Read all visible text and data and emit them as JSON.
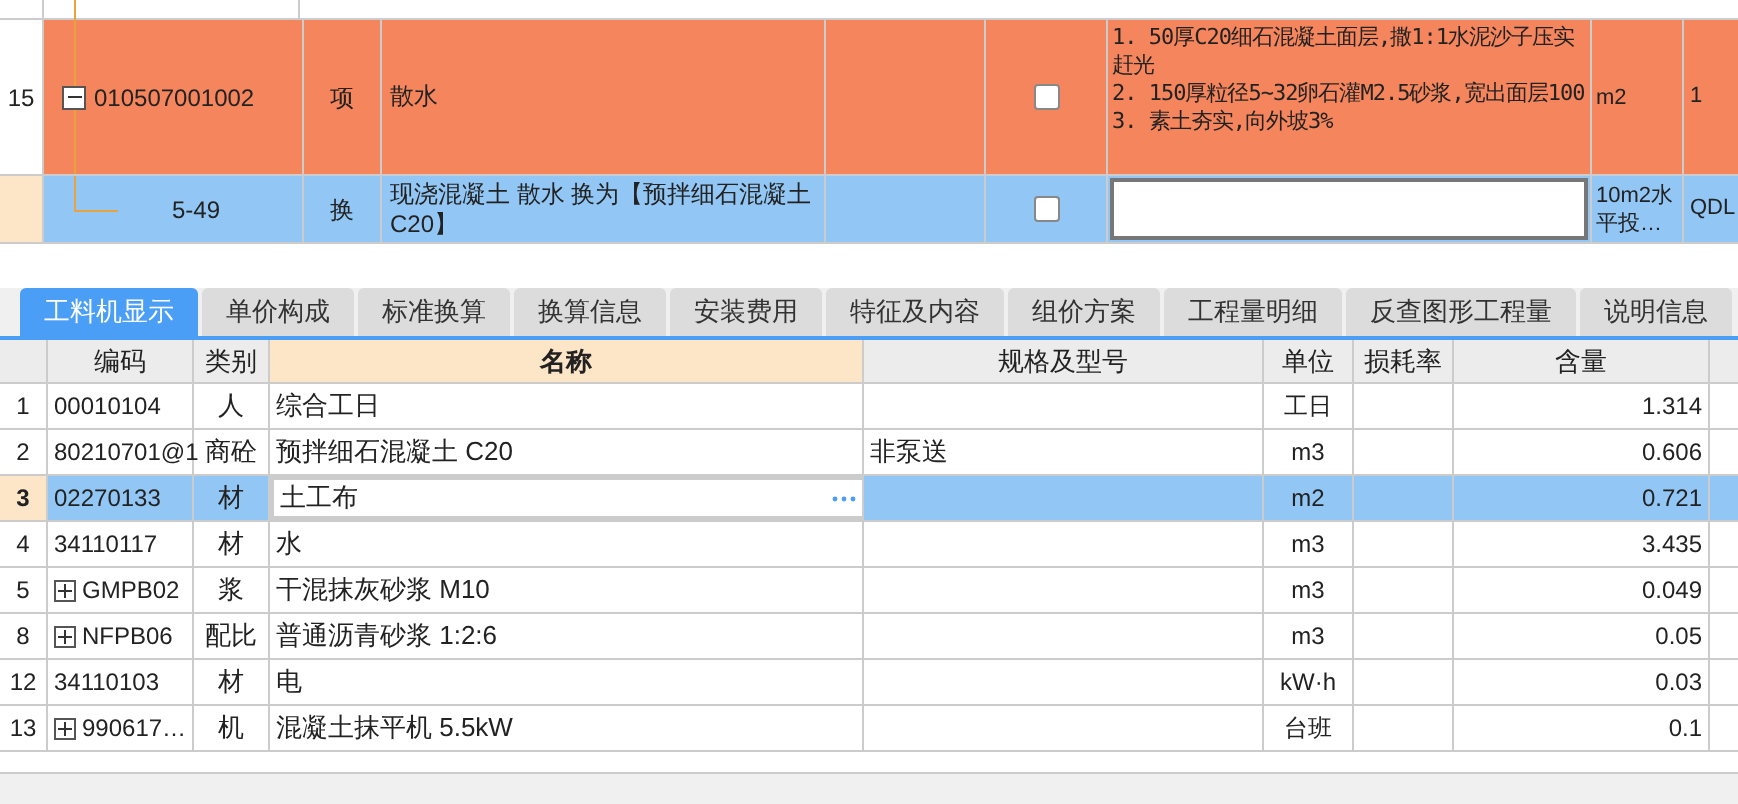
{
  "upper_table": {
    "rows": [
      {
        "row_number": "15",
        "code": "010507001002",
        "expanded": true,
        "type": "项",
        "name": "散水",
        "checked": false,
        "description": "1. 50厚C20细石混凝土面层,撒1:1水泥沙子压实赶光\n2. 150厚粒径5~32卵石灌M2.5砂浆,宽出面层100\n3. 素土夯实,向外坡3%",
        "unit": "m2",
        "quantity": "1",
        "selected": false,
        "editing": false
      },
      {
        "row_number": "",
        "code": "5-49",
        "type": "换",
        "name": "现浇混凝土 散水  换为【预拌细石混凝土 C20】",
        "checked": false,
        "description": "",
        "unit": "10m2水平投…",
        "quantity": "QDL",
        "selected": true,
        "editing": true
      }
    ]
  },
  "tabs": [
    {
      "label": "工料机显示",
      "selected": true
    },
    {
      "label": "单价构成",
      "selected": false
    },
    {
      "label": "标准换算",
      "selected": false
    },
    {
      "label": "换算信息",
      "selected": false
    },
    {
      "label": "安装费用",
      "selected": false
    },
    {
      "label": "特征及内容",
      "selected": false
    },
    {
      "label": "组价方案",
      "selected": false
    },
    {
      "label": "工程量明细",
      "selected": false
    },
    {
      "label": "反查图形工程量",
      "selected": false
    },
    {
      "label": "说明信息",
      "selected": false
    }
  ],
  "lower_table": {
    "columns": [
      "编码",
      "类别",
      "名称",
      "规格及型号",
      "单位",
      "损耗率",
      "含量"
    ],
    "rows": [
      {
        "index": "1",
        "code": "00010104",
        "type": "人",
        "name": "综合工日",
        "spec": "",
        "unit": "工日",
        "loss": "",
        "amount": "1.314",
        "selected": false
      },
      {
        "index": "2",
        "code": "80210701@1",
        "type": "商砼",
        "name": "预拌细石混凝土 C20",
        "spec": "非泵送",
        "unit": "m3",
        "loss": "",
        "amount": "0.606",
        "selected": false
      },
      {
        "index": "3",
        "code": "02270133",
        "type": "材",
        "name": "土工布",
        "spec": "",
        "unit": "m2",
        "loss": "",
        "amount": "0.721",
        "selected": true
      },
      {
        "index": "4",
        "code": "34110117",
        "type": "材",
        "name": "水",
        "spec": "",
        "unit": "m3",
        "loss": "",
        "amount": "3.435",
        "selected": false
      },
      {
        "index": "5",
        "code": "GMPB02",
        "expandable": true,
        "type": "浆",
        "name": "干混抹灰砂浆 M10",
        "spec": "",
        "unit": "m3",
        "loss": "",
        "amount": "0.049",
        "selected": false
      },
      {
        "index": "8",
        "code": "NFPB06",
        "expandable": true,
        "type": "配比",
        "name": "普通沥青砂浆 1:2:6",
        "spec": "",
        "unit": "m3",
        "loss": "",
        "amount": "0.05",
        "selected": false
      },
      {
        "index": "12",
        "code": "34110103",
        "type": "材",
        "name": "电",
        "spec": "",
        "unit": "kW·h",
        "loss": "",
        "amount": "0.03",
        "selected": false
      },
      {
        "index": "13",
        "code": "990617…",
        "expandable": true,
        "type": "机",
        "name": "混凝土抹平机 5.5kW",
        "spec": "",
        "unit": "台班",
        "loss": "",
        "amount": "0.1",
        "selected": false
      }
    ]
  }
}
